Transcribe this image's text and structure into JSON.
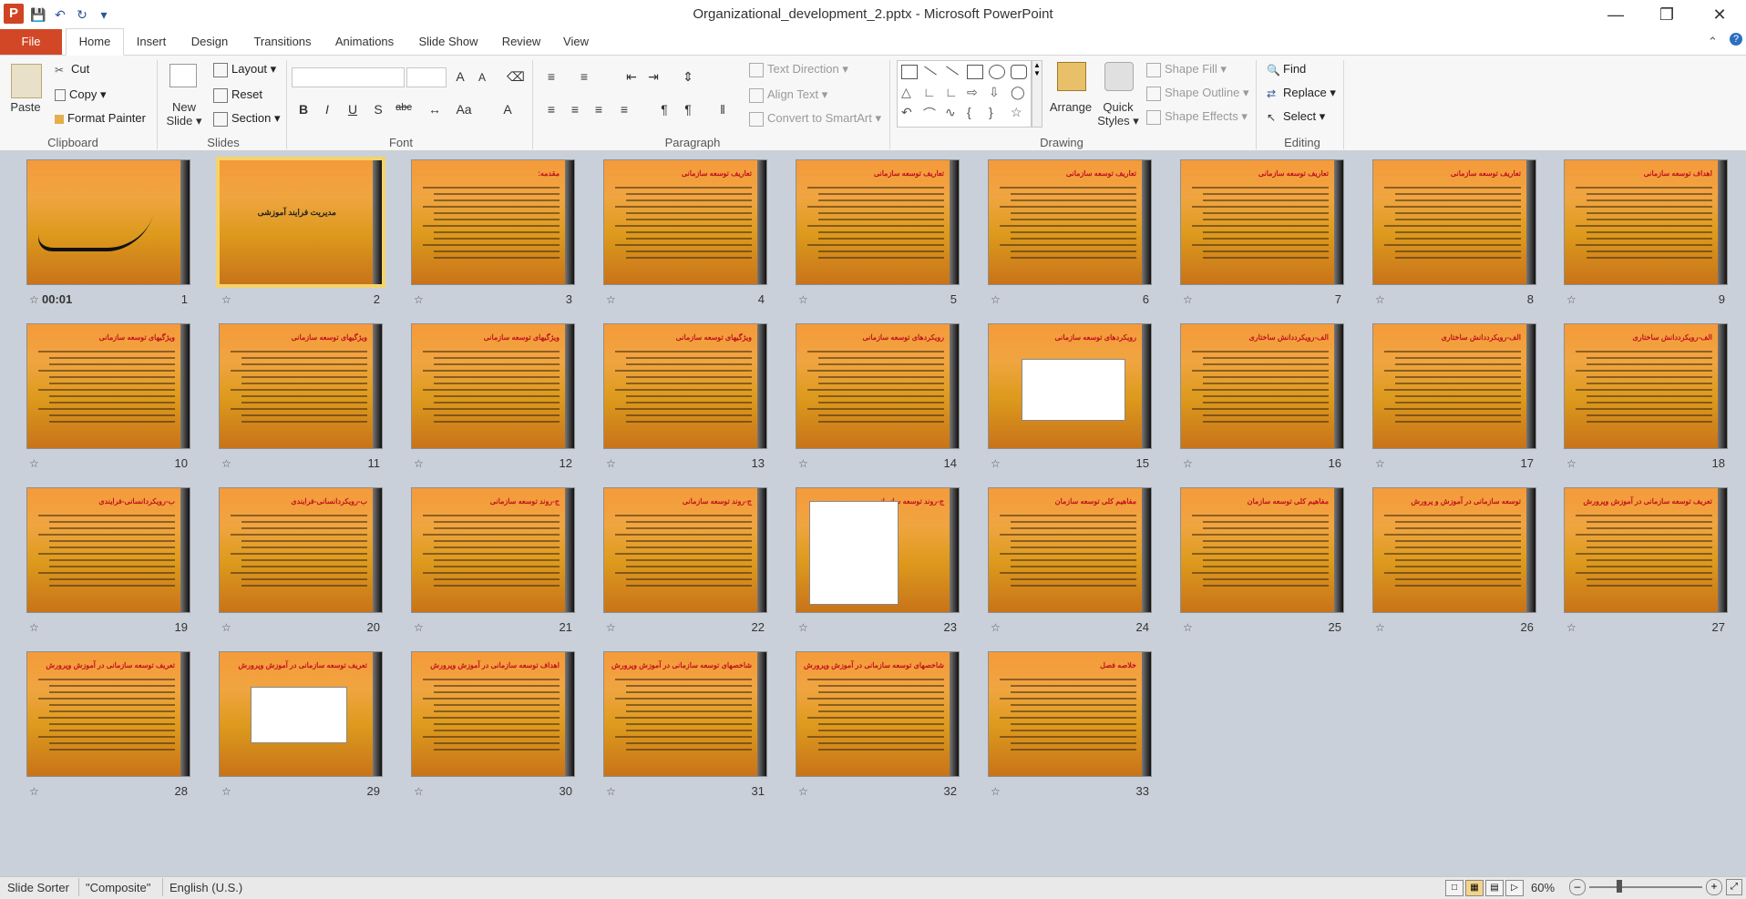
{
  "window": {
    "title": "Organizational_development_2.pptx - Microsoft PowerPoint",
    "app_icon": "P",
    "qat_icons": [
      "save-icon",
      "undo-icon",
      "redo-icon",
      "customize-icon"
    ],
    "controls": [
      "minimize-icon",
      "restore-icon",
      "close-icon"
    ]
  },
  "tabs": [
    {
      "label": "File"
    },
    {
      "label": "Home"
    },
    {
      "label": "Insert"
    },
    {
      "label": "Design"
    },
    {
      "label": "Transitions"
    },
    {
      "label": "Animations"
    },
    {
      "label": "Slide Show"
    },
    {
      "label": "Review"
    },
    {
      "label": "View"
    }
  ],
  "ribbon": {
    "clipboard": {
      "paste": "Paste",
      "cut": "Cut",
      "copy": "Copy",
      "format_painter": "Format Painter",
      "label": "Clipboard"
    },
    "slides": {
      "new_slide_line1": "New",
      "new_slide_line2": "Slide",
      "layout": "Layout",
      "reset": "Reset",
      "section": "Section",
      "label": "Slides"
    },
    "font": {
      "label": "Font"
    },
    "paragraph": {
      "text_direction": "Text Direction",
      "align_text": "Align Text",
      "convert_smartart": "Convert to SmartArt",
      "label": "Paragraph"
    },
    "drawing": {
      "arrange": "Arrange",
      "quick_styles_line1": "Quick",
      "quick_styles_line2": "Styles",
      "shape_fill": "Shape Fill",
      "shape_outline": "Shape Outline",
      "shape_effects": "Shape Effects",
      "label": "Drawing"
    },
    "editing": {
      "find": "Find",
      "replace": "Replace",
      "select": "Select",
      "label": "Editing"
    }
  },
  "slides": [
    {
      "num": "1",
      "title": "",
      "time": "00:01"
    },
    {
      "num": "2",
      "title": "مدیریت فرایند آموزشی"
    },
    {
      "num": "3",
      "title": "مقدمه:"
    },
    {
      "num": "4",
      "title": "تعاریف توسعه سازمانی"
    },
    {
      "num": "5",
      "title": "تعاریف توسعه سازمانی"
    },
    {
      "num": "6",
      "title": "تعاریف توسعه سازمانی"
    },
    {
      "num": "7",
      "title": "تعاریف توسعه سازمانی"
    },
    {
      "num": "8",
      "title": "تعاریف توسعه سازمانی"
    },
    {
      "num": "9",
      "title": "اهداف توسعه سازمانی"
    },
    {
      "num": "10",
      "title": "ویژگیهای توسعه سازمانی"
    },
    {
      "num": "11",
      "title": "ویژگیهای توسعه سازمانی"
    },
    {
      "num": "12",
      "title": "ویژگیهای توسعه سازمانی"
    },
    {
      "num": "13",
      "title": "ویژگیهای توسعه سازمانی"
    },
    {
      "num": "14",
      "title": "رویکردهای توسعه سازمانی"
    },
    {
      "num": "15",
      "title": "رویکردهای توسعه سازمانی"
    },
    {
      "num": "16",
      "title": "الف-رویکرددانش ساختاری"
    },
    {
      "num": "17",
      "title": "الف-رویکرددانش ساختاری"
    },
    {
      "num": "18",
      "title": "الف-رویکرددانش ساختاری"
    },
    {
      "num": "19",
      "title": "ب-رویکردانسانی-فرایندی"
    },
    {
      "num": "20",
      "title": "ب-رویکردانسانی-فرایندی"
    },
    {
      "num": "21",
      "title": "ج-روند توسعه سازمانی"
    },
    {
      "num": "22",
      "title": "ج-روند توسعه سازمانی"
    },
    {
      "num": "23",
      "title": "ج-روند توسعه سازمانی"
    },
    {
      "num": "24",
      "title": "مفاهیم کلی توسعه سازمان"
    },
    {
      "num": "25",
      "title": "مفاهیم کلی توسعه سازمان"
    },
    {
      "num": "26",
      "title": "توسعه سازمانی در آموزش و پرورش"
    },
    {
      "num": "27",
      "title": "تعریف توسعه سازمانی در آموزش وپرورش"
    },
    {
      "num": "28",
      "title": "تعریف توسعه سازمانی در آموزش وپرورش"
    },
    {
      "num": "29",
      "title": "تعریف توسعه سازمانی در آموزش وپرورش"
    },
    {
      "num": "30",
      "title": "اهداف توسعه سازمانی در آموزش وپرورش"
    },
    {
      "num": "31",
      "title": "شاخصهای توسعه سازمانی در آموزش وپرورش"
    },
    {
      "num": "32",
      "title": "شاخصهای توسعه سازمانی در آموزش وپرورش"
    },
    {
      "num": "33",
      "title": "خلاصه فصل"
    }
  ],
  "status": {
    "view": "Slide Sorter",
    "theme": "\"Composite\"",
    "language": "English (U.S.)",
    "zoom": "60%"
  }
}
